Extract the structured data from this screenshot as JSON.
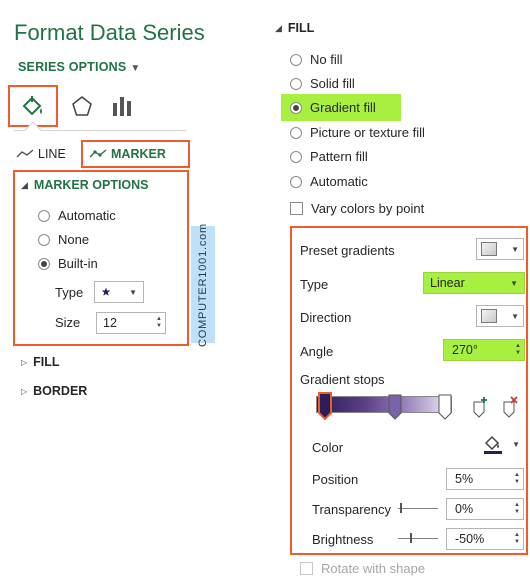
{
  "panel": {
    "title": "Format Data Series",
    "series_options_label": "SERIES OPTIONS",
    "tabs": {
      "line": "LINE",
      "marker": "MARKER"
    }
  },
  "marker_options": {
    "header": "MARKER OPTIONS",
    "options": [
      "Automatic",
      "None",
      "Built-in"
    ],
    "selected": "Built-in",
    "type_label": "Type",
    "size_label": "Size",
    "size_value": "12"
  },
  "left_sections": {
    "fill": "FILL",
    "border": "BORDER"
  },
  "watermark": "COMPUTER1001.com",
  "fill": {
    "header": "FILL",
    "options": [
      "No fill",
      "Solid fill",
      "Gradient fill",
      "Picture or texture fill",
      "Pattern fill",
      "Automatic"
    ],
    "selected": "Gradient fill",
    "vary_colors": "Vary colors by point"
  },
  "gradient": {
    "preset_label": "Preset gradients",
    "type_label": "Type",
    "type_value": "Linear",
    "direction_label": "Direction",
    "angle_label": "Angle",
    "angle_value": "270°",
    "stops_label": "Gradient stops",
    "color_label": "Color",
    "position_label": "Position",
    "position_value": "5%",
    "transparency_label": "Transparency",
    "transparency_value": "0%",
    "brightness_label": "Brightness",
    "brightness_value": "-50%",
    "rotate_label": "Rotate with shape"
  },
  "colors": {
    "accent_green": "#217346",
    "highlight_green": "#a8f040",
    "annotation_orange": "#ef5b2a",
    "marker_purple": "#2b1d57"
  }
}
